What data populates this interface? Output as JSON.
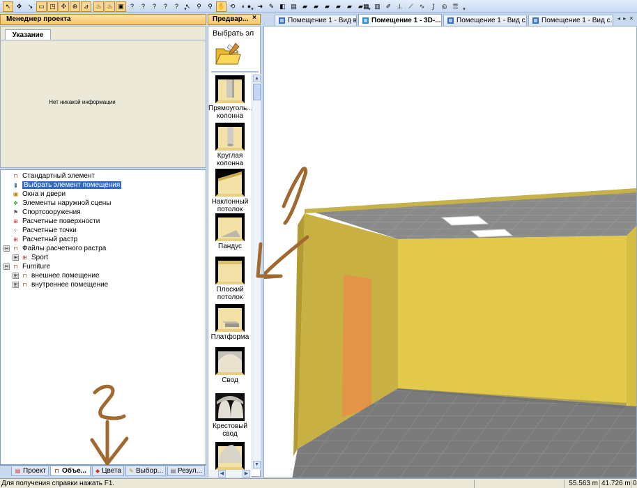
{
  "toolbar": {
    "groups": [
      {
        "buttons": [
          {
            "icon": "select-cursor-icon",
            "glyph": "↖",
            "active": true
          },
          {
            "icon": "move-icon",
            "glyph": "✥",
            "active": false
          },
          {
            "icon": "select-multi-icon",
            "glyph": "↘",
            "active": false
          },
          {
            "icon": "draw-rect-icon",
            "glyph": "▭",
            "active": true
          },
          {
            "icon": "draw-room-icon",
            "glyph": "◳",
            "active": true
          },
          {
            "icon": "point-icon",
            "glyph": "✣",
            "active": true
          },
          {
            "icon": "zoom-select-icon",
            "glyph": "⊕",
            "active": true
          },
          {
            "icon": "measure-icon",
            "glyph": "⊿",
            "active": true
          }
        ]
      },
      {
        "buttons": [
          {
            "icon": "luminaire-red-icon",
            "glyph": "♨",
            "active": true
          },
          {
            "icon": "luminaire-red2-icon",
            "glyph": "♨",
            "active": true
          },
          {
            "icon": "luminaire-box-icon",
            "glyph": "▣",
            "active": true
          },
          {
            "icon": "question-icon",
            "glyph": "?",
            "active": false
          },
          {
            "icon": "question2-icon",
            "glyph": "?",
            "active": false
          },
          {
            "icon": "question3-icon",
            "glyph": "?",
            "active": false
          },
          {
            "icon": "question4-icon",
            "glyph": "?",
            "active": false
          },
          {
            "icon": "question5-icon",
            "glyph": "?",
            "active": false
          }
        ]
      },
      {
        "buttons": [
          {
            "icon": "pointer-icon",
            "glyph": "↖",
            "active": false
          },
          {
            "icon": "magnify-icon",
            "glyph": "⚲",
            "active": false
          },
          {
            "icon": "zoom-dropdown-icon",
            "glyph": "⚲",
            "active": false
          },
          {
            "icon": "hand-pan-icon",
            "glyph": "✋",
            "active": true
          },
          {
            "icon": "rotate-icon",
            "glyph": "⟲",
            "active": false
          },
          {
            "icon": "view-icon",
            "glyph": "◐",
            "active": false
          }
        ]
      },
      {
        "buttons": [
          {
            "icon": "render-icon",
            "glyph": "●",
            "active": false
          },
          {
            "icon": "arrow-green-icon",
            "glyph": "➜",
            "active": false
          },
          {
            "icon": "paint-icon",
            "glyph": "✎",
            "active": false
          },
          {
            "icon": "camera-icon",
            "glyph": "◧",
            "active": false
          },
          {
            "icon": "frame-icon",
            "glyph": "▤",
            "active": false
          },
          {
            "icon": "folder-icon",
            "glyph": "▰",
            "active": false
          },
          {
            "icon": "folder2-icon",
            "glyph": "▰",
            "active": false
          },
          {
            "icon": "folder3-icon",
            "glyph": "▰",
            "active": false
          },
          {
            "icon": "folder4-icon",
            "glyph": "▰",
            "active": false
          },
          {
            "icon": "folder5-icon",
            "glyph": "▰",
            "active": false
          },
          {
            "icon": "folder6-icon",
            "glyph": "▰",
            "active": false
          }
        ]
      },
      {
        "buttons": [
          {
            "icon": "grid-icon",
            "glyph": "▦",
            "active": false
          },
          {
            "icon": "table-icon",
            "glyph": "▥",
            "active": false
          },
          {
            "icon": "edit-icon",
            "glyph": "✐",
            "active": false
          },
          {
            "icon": "level-icon",
            "glyph": "⊥",
            "active": false
          },
          {
            "icon": "line-icon",
            "glyph": "⟋",
            "active": false
          },
          {
            "icon": "polyline-icon",
            "glyph": "∿",
            "active": false
          },
          {
            "icon": "curve-icon",
            "glyph": "ʃ",
            "active": false
          },
          {
            "icon": "target-icon",
            "glyph": "◎",
            "active": false
          },
          {
            "icon": "list-icon",
            "glyph": "☰",
            "active": false
          }
        ]
      }
    ]
  },
  "project_manager": {
    "title": "Менеджер проекта",
    "tab": "Указание",
    "empty_message": "Нет никакой информации"
  },
  "tree": [
    {
      "label": "Стандартный элемент",
      "icon": "table-furniture-icon",
      "glyph": "⊓",
      "color": "#a0522d",
      "level": 0,
      "expander": "",
      "selected": false
    },
    {
      "label": "Выбрать элемент помещения",
      "icon": "room-element-icon",
      "glyph": "▮",
      "color": "#4a7fb5",
      "level": 0,
      "expander": "",
      "selected": true
    },
    {
      "label": "Окна и двери",
      "icon": "window-door-icon",
      "glyph": "▣",
      "color": "#b8860b",
      "level": 0,
      "expander": "",
      "selected": false
    },
    {
      "label": "Элементы наружной сцены",
      "icon": "outdoor-scene-icon",
      "glyph": "❖",
      "color": "#3a9a3a",
      "level": 0,
      "expander": "",
      "selected": false
    },
    {
      "label": "Спортсооружения",
      "icon": "sport-icon",
      "glyph": "⚑",
      "color": "#555555",
      "level": 0,
      "expander": "",
      "selected": false
    },
    {
      "label": "Расчетные поверхности",
      "icon": "calc-surface-icon",
      "glyph": "⊞",
      "color": "#cc3333",
      "level": 0,
      "expander": "",
      "selected": false
    },
    {
      "label": "Расчетные точки",
      "icon": "calc-points-icon",
      "glyph": "⁘",
      "color": "#333333",
      "level": 0,
      "expander": "",
      "selected": false
    },
    {
      "label": "Расчетный растр",
      "icon": "calc-raster-icon",
      "glyph": "⊞",
      "color": "#cc3333",
      "level": 0,
      "expander": "",
      "selected": false
    },
    {
      "label": "Файлы расчетного растра",
      "icon": "raster-files-icon",
      "glyph": "⊓",
      "color": "#a0522d",
      "level": 0,
      "expander": "⊟",
      "selected": false
    },
    {
      "label": "Sport",
      "icon": "raster-sport-icon",
      "glyph": "⊞",
      "color": "#cc3333",
      "level": 1,
      "expander": "⊞",
      "selected": false
    },
    {
      "label": "Furniture",
      "icon": "furniture-icon",
      "glyph": "⊓",
      "color": "#a0522d",
      "level": 0,
      "expander": "⊟",
      "selected": false
    },
    {
      "label": "внешнее помещение",
      "icon": "furniture-outer-icon",
      "glyph": "⊓",
      "color": "#a0522d",
      "level": 1,
      "expander": "⊞",
      "selected": false
    },
    {
      "label": "внутреннее помещение",
      "icon": "furniture-inner-icon",
      "glyph": "⊓",
      "color": "#a0522d",
      "level": 1,
      "expander": "⊞",
      "selected": false
    }
  ],
  "bottom_tabs": [
    {
      "label": "Проект",
      "icon": "project-tab-icon",
      "glyph": "▤",
      "color": "#cc3333",
      "active": false
    },
    {
      "label": "Объе...",
      "icon": "objects-tab-icon",
      "glyph": "⊓",
      "color": "#a0522d",
      "active": true
    },
    {
      "label": "Цвета",
      "icon": "colors-tab-icon",
      "glyph": "◆",
      "color": "#c0392b",
      "active": false
    },
    {
      "label": "Выбор...",
      "icon": "selection-tab-icon",
      "glyph": "✎",
      "color": "#b8860b",
      "active": false
    },
    {
      "label": "Резул...",
      "icon": "results-tab-icon",
      "glyph": "▤",
      "color": "#555555",
      "active": false
    }
  ],
  "preview": {
    "header": "Предвар...",
    "close_glyph": "×",
    "title": "Выбрать эл",
    "items": [
      {
        "label": "Прямоуголь... колонна",
        "name": "preview-item-rect-column",
        "shape": "rect-column"
      },
      {
        "label": "Круглая колонна",
        "name": "preview-item-round-column",
        "shape": "round-column"
      },
      {
        "label": "Наклонный потолок",
        "name": "preview-item-sloped-ceiling",
        "shape": "sloped"
      },
      {
        "label": "Пандус",
        "name": "preview-item-ramp",
        "shape": "ramp"
      },
      {
        "label": "Плоский потолок",
        "name": "preview-item-flat-ceiling",
        "shape": "flat"
      },
      {
        "label": "Платформа",
        "name": "preview-item-platform",
        "shape": "platform"
      },
      {
        "label": "Свод",
        "name": "preview-item-vault",
        "shape": "vault"
      },
      {
        "label": "Крестовый свод",
        "name": "preview-item-cross-vault",
        "shape": "cross-vault"
      },
      {
        "label": "",
        "name": "preview-item-dome",
        "shape": "dome"
      }
    ]
  },
  "documents": {
    "tabs": [
      {
        "label": "Помещение 1 - Вид в ...",
        "active": false,
        "icon_color": "#3a6fc4"
      },
      {
        "label": "Помещение 1 - 3D-...",
        "active": true,
        "icon_color": "#2a8fd6"
      },
      {
        "label": "Помещение 1 - Вид с...",
        "active": false,
        "icon_color": "#3a6fc4"
      },
      {
        "label": "Помещение 1 - Вид с...",
        "active": false,
        "icon_color": "#3a6fc4"
      }
    ],
    "nav": "◂ ▸ ✕"
  },
  "annotations": {
    "mark1": "1",
    "mark2": "2"
  },
  "status": {
    "help": "Для получения справки нажать F1.",
    "x": "55.563 m",
    "y": "41.726 m",
    "z": "0"
  }
}
